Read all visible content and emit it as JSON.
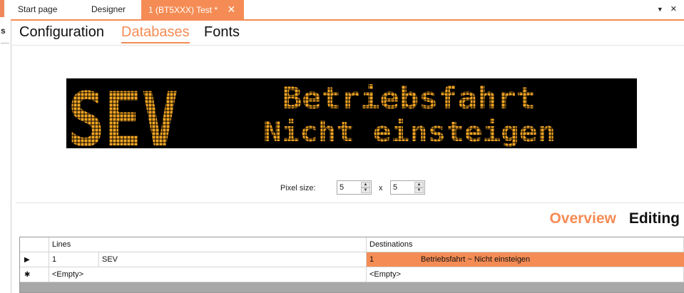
{
  "left_panel": {
    "letter": "s"
  },
  "tabs": [
    {
      "label": "Start page"
    },
    {
      "label": "Designer"
    },
    {
      "label": "1 (BT5XXX) Test *",
      "active": true
    }
  ],
  "tab_close_icon": "close-icon",
  "subtabs": [
    {
      "label": "Configuration"
    },
    {
      "label": "Databases",
      "active": true
    },
    {
      "label": "Fonts"
    }
  ],
  "led_display": {
    "left_text": "SEV",
    "line1": "Betriebsfahrt",
    "line2": "Nicht einsteigen",
    "color": "#f5a623",
    "background": "#000000"
  },
  "pixel_size": {
    "label": "Pixel size:",
    "width": "5",
    "separator": "x",
    "height": "5"
  },
  "view_tabs": {
    "overview": "Overview",
    "editing": "Editing"
  },
  "grid": {
    "headers": {
      "lines": "Lines",
      "destinations": "Destinations"
    },
    "rows": [
      {
        "indicator": "▶",
        "line_no": "1",
        "line_name": "SEV",
        "dest_no": "1",
        "dest_text": "Betriebsfahrt ~ Nicht einsteigen"
      },
      {
        "indicator": "✱",
        "line_empty": "<Empty>",
        "dest_empty": "<Empty>"
      }
    ]
  },
  "colors": {
    "accent": "#f58c55"
  }
}
